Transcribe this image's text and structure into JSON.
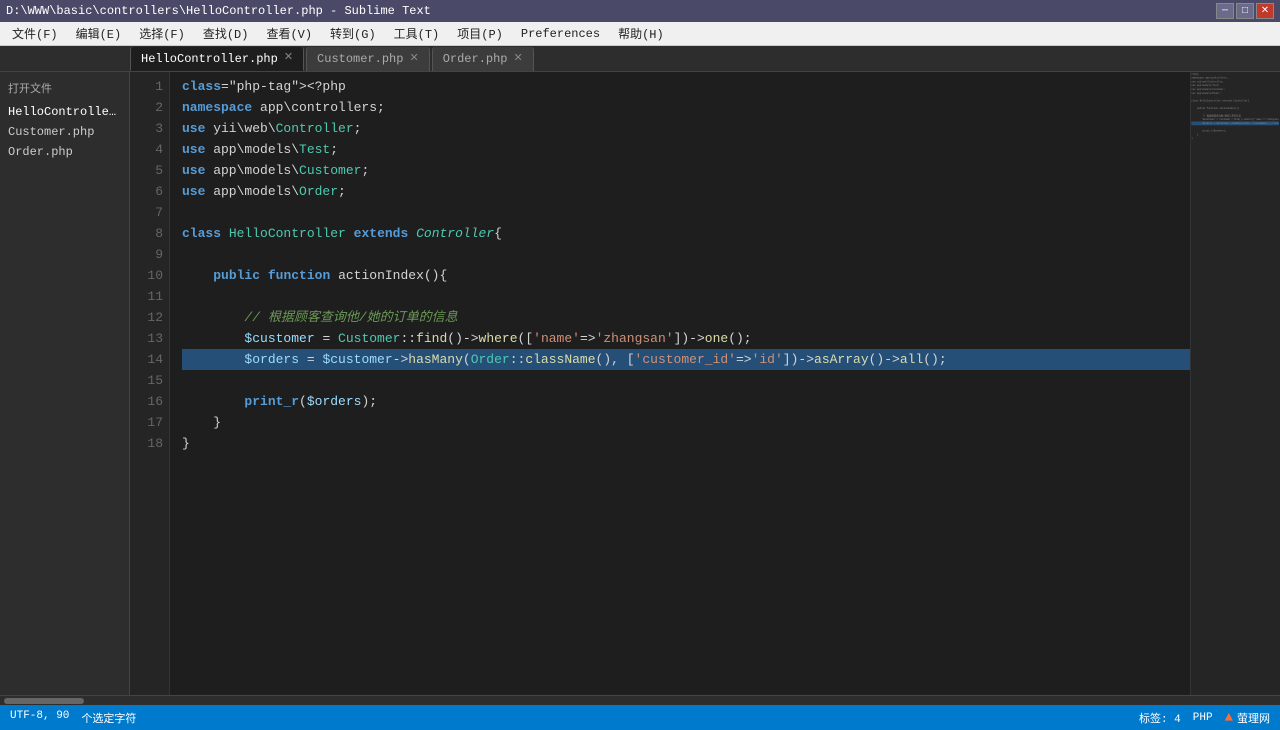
{
  "titleBar": {
    "title": "D:\\WWW\\basic\\controllers\\HelloController.php - Sublime Text",
    "controls": [
      "minimize",
      "maximize",
      "close"
    ]
  },
  "menuBar": {
    "items": [
      "文件(F)",
      "编辑(E)",
      "选择(F)",
      "查找(D)",
      "查看(V)",
      "转到(G)",
      "工具(T)",
      "项目(P)",
      "Preferences",
      "帮助(H)"
    ]
  },
  "sidebar": {
    "title": "打开文件",
    "items": [
      {
        "label": "HelloController.php",
        "active": true
      },
      {
        "label": "Customer.php",
        "active": false
      },
      {
        "label": "Order.php",
        "active": false
      }
    ]
  },
  "tabs": [
    {
      "label": "HelloController.php",
      "active": true
    },
    {
      "label": "Customer.php",
      "active": false
    },
    {
      "label": "Order.php",
      "active": false
    }
  ],
  "statusBar": {
    "left": [
      "UTF-8, 90",
      "个选定字符"
    ],
    "right": [
      "标签: 4",
      "PHP"
    ],
    "brand": "萤理网"
  },
  "code": {
    "lines": [
      {
        "num": 1,
        "content": "<?php",
        "highlight": false
      },
      {
        "num": 2,
        "content": "namespace app\\controllers;",
        "highlight": false
      },
      {
        "num": 3,
        "content": "use yii\\web\\Controller;",
        "highlight": false
      },
      {
        "num": 4,
        "content": "use app\\models\\Test;",
        "highlight": false
      },
      {
        "num": 5,
        "content": "use app\\models\\Customer;",
        "highlight": false
      },
      {
        "num": 6,
        "content": "use app\\models\\Order;",
        "highlight": false
      },
      {
        "num": 7,
        "content": "",
        "highlight": false
      },
      {
        "num": 8,
        "content": "class HelloController extends Controller{",
        "highlight": false
      },
      {
        "num": 9,
        "content": "",
        "highlight": false
      },
      {
        "num": 10,
        "content": "    public function actionIndex(){",
        "highlight": false
      },
      {
        "num": 11,
        "content": "",
        "highlight": false
      },
      {
        "num": 12,
        "content": "        // 根据顾客查询他/她的订单的信息",
        "highlight": false
      },
      {
        "num": 13,
        "content": "        $customer = Customer::find()->where(['name'=>'zhangsan'])->one();",
        "highlight": false
      },
      {
        "num": 14,
        "content": "        $orders = $customer->hasMany(Order::className(), ['customer_id'=>'id'])->asArray()->all();",
        "highlight": true
      },
      {
        "num": 15,
        "content": "",
        "highlight": false
      },
      {
        "num": 16,
        "content": "        print_r($orders);",
        "highlight": false
      },
      {
        "num": 17,
        "content": "    }",
        "highlight": false
      },
      {
        "num": 18,
        "content": "}",
        "highlight": false
      }
    ]
  }
}
